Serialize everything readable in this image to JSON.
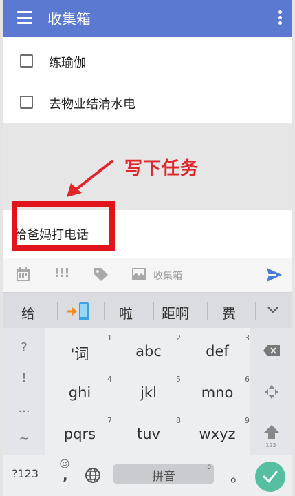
{
  "app_bar": {
    "title": "收集箱",
    "menu_icon": "hamburger-menu-icon",
    "overflow_icon": "more-vertical-icon",
    "color": "#5b79d0"
  },
  "tasks": [
    {
      "label": "练瑜伽",
      "checked": false
    },
    {
      "label": "去物业结清水电",
      "checked": false
    }
  ],
  "annotation": {
    "text": "写下任务",
    "color": "#e1262b"
  },
  "input": {
    "value": "给爸妈打电话"
  },
  "toolbar": {
    "calendar_icon": "calendar-icon",
    "priority_label": "!!!",
    "tag_icon": "tag-icon",
    "list_icon": "inbox-icon",
    "list_label": "收集箱",
    "send_icon": "send-icon",
    "accent": "#4a7bd9"
  },
  "candidates": {
    "items": [
      "给",
      "啦",
      "距啊",
      "费"
    ],
    "phone_icon": "phone-arrow-icon",
    "expand_icon": "chevron-down-icon"
  },
  "keyboard": {
    "side_keys": [
      "?",
      "!",
      "...",
      "~"
    ],
    "keys": [
      {
        "num": "1",
        "label": "'词"
      },
      {
        "num": "2",
        "label": "abc"
      },
      {
        "num": "3",
        "label": "def"
      },
      {
        "num": "4",
        "label": "ghi"
      },
      {
        "num": "5",
        "label": "jkl"
      },
      {
        "num": "6",
        "label": "mno"
      },
      {
        "num": "7",
        "label": "pqrs"
      },
      {
        "num": "8",
        "label": "tuv"
      },
      {
        "num": "9",
        "label": "wxyz"
      }
    ],
    "right_keys": {
      "backspace_icon": "backspace-icon",
      "cursor_icon": "cursor-move-icon",
      "shift_icon": "shift-arrow-icon",
      "shift_sub": "123"
    },
    "bottom": {
      "symbols": "?123",
      "emoji_icon": "emoji-icon",
      "comma": ",",
      "globe_icon": "globe-icon",
      "space_label": "拼音",
      "space_num": "0",
      "period": "。",
      "done_icon": "checkmark-icon",
      "done_color": "#57bfa1"
    }
  }
}
